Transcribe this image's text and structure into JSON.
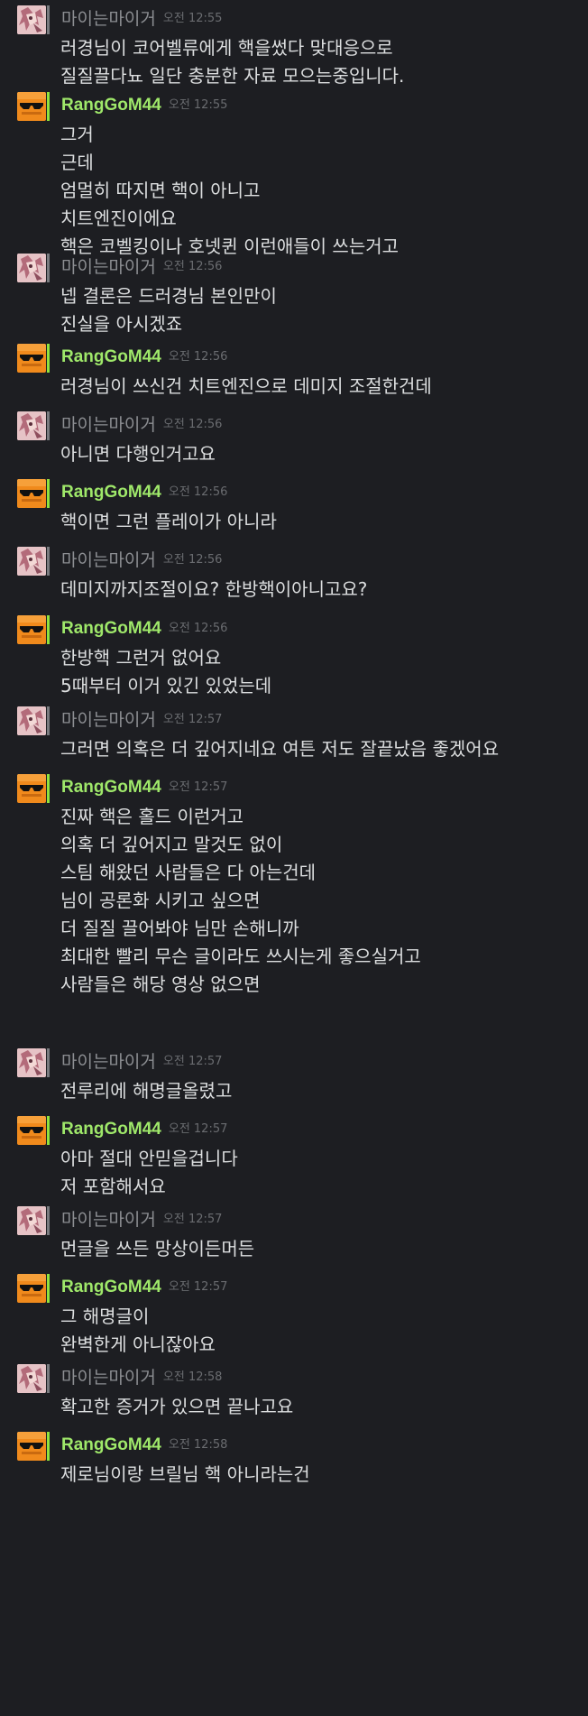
{
  "messages": [
    {
      "author": "마이는마이거",
      "author_status": "offline",
      "time": "오전 12:55",
      "lines": [
        "러경님이 코어벨류에게 핵을썼다 맞대응으로",
        "질질끌다뇨 일단 충분한 자료 모으는중입니다."
      ]
    },
    {
      "author": "RangGoM44",
      "author_status": "online",
      "time": "오전 12:55",
      "lines": [
        "그거",
        "근데",
        "엄멀히 따지면 핵이 아니고",
        "치트엔진이에요",
        "핵은 코벨킹이나 호넷퀸 이런애들이 쓰는거고"
      ]
    },
    {
      "author": "마이는마이거",
      "author_status": "offline",
      "time": "오전 12:56",
      "lines": [
        "넵 결론은 드러경님 본인만이",
        "진실을 아시겠죠"
      ]
    },
    {
      "author": "RangGoM44",
      "author_status": "online",
      "time": "오전 12:56",
      "lines": [
        "러경님이 쓰신건 치트엔진으로 데미지 조절한건데"
      ]
    },
    {
      "author": "마이는마이거",
      "author_status": "offline",
      "time": "오전 12:56",
      "lines": [
        "아니면 다행인거고요"
      ]
    },
    {
      "author": "RangGoM44",
      "author_status": "online",
      "time": "오전 12:56",
      "lines": [
        "핵이면 그런 플레이가 아니라"
      ]
    },
    {
      "author": "마이는마이거",
      "author_status": "offline",
      "time": "오전 12:56",
      "lines": [
        "데미지까지조절이요? 한방핵이아니고요?"
      ]
    },
    {
      "author": "RangGoM44",
      "author_status": "online",
      "time": "오전 12:56",
      "lines": [
        "한방핵 그런거 없어요",
        "5때부터 이거 있긴 있었는데"
      ]
    },
    {
      "author": "마이는마이거",
      "author_status": "offline",
      "time": "오전 12:57",
      "lines": [
        "그러면 의혹은 더 깊어지네요 여튼 저도 잘끝났음 좋겠어요"
      ]
    },
    {
      "author": "RangGoM44",
      "author_status": "online",
      "time": "오전 12:57",
      "lines": [
        "진짜 핵은 홀드 이런거고",
        "의혹 더 깊어지고 말것도 없이",
        "스팀 해왔던 사람들은 다 아는건데",
        "님이 공론화 시키고 싶으면",
        "더 질질 끌어봐야 님만 손해니까",
        "최대한 빨리 무슨 글이라도 쓰시는게 좋으실거고",
        "사람들은 해당 영상 없으면"
      ]
    },
    {
      "author": "마이는마이거",
      "author_status": "offline",
      "time": "오전 12:57",
      "lines": [
        "전루리에 해명글올렸고"
      ]
    },
    {
      "author": "RangGoM44",
      "author_status": "online",
      "time": "오전 12:57",
      "lines": [
        "아마 절대 안믿을겁니다",
        "저 포함해서요"
      ]
    },
    {
      "author": "마이는마이거",
      "author_status": "offline",
      "time": "오전 12:57",
      "lines": [
        "먼글을 쓰든 망상이든머든"
      ]
    },
    {
      "author": "RangGoM44",
      "author_status": "online",
      "time": "오전 12:57",
      "lines": [
        "그 해명글이",
        "완벽한게 아니잖아요"
      ]
    },
    {
      "author": "마이는마이거",
      "author_status": "offline",
      "time": "오전 12:58",
      "lines": [
        "확고한 증거가 있으면 끝나고요"
      ]
    },
    {
      "author": "RangGoM44",
      "author_status": "online",
      "time": "오전 12:58",
      "lines": [
        "제로님이랑 브릴님 핵 아니라는건"
      ]
    }
  ],
  "avatars": {
    "offline": "anime-character-avatar",
    "online": "sunglasses-avatar"
  },
  "colors": {
    "background": "#1d1e22",
    "offline_name": "#8c8e92",
    "online_name": "#9fe86a",
    "online_bar": "#8ee33e",
    "offline_bar": "#7a7c80",
    "message_text": "#dcdedf",
    "timestamp": "#6a6c70"
  }
}
